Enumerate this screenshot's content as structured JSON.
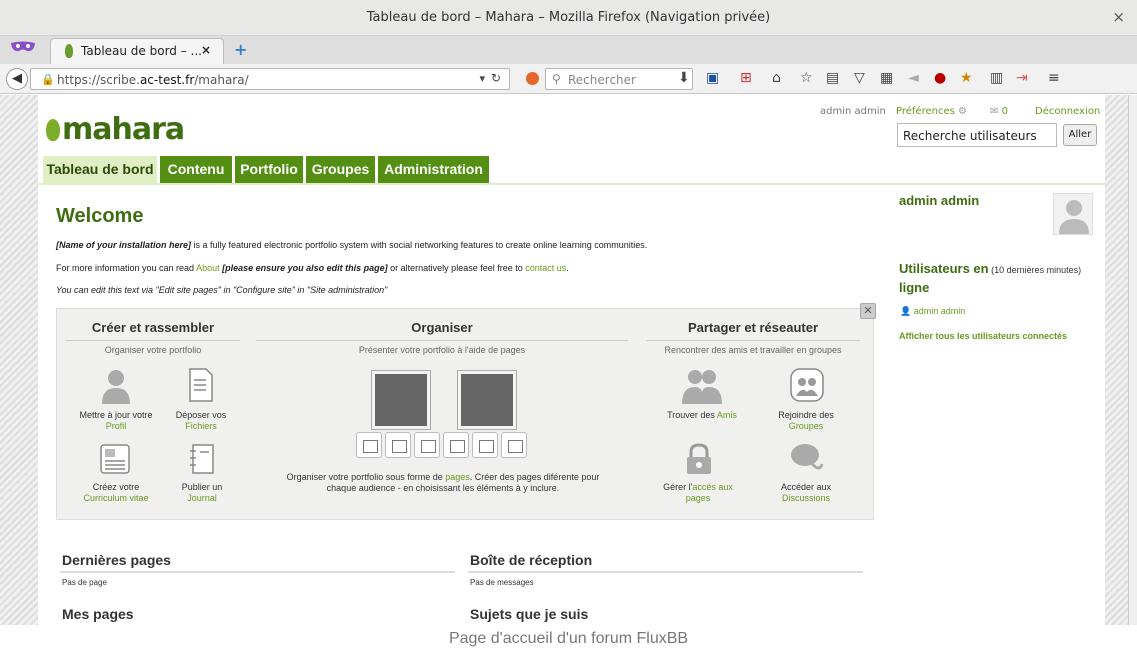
{
  "browser": {
    "window_title": "Tableau de bord – Mahara – Mozilla Firefox (Navigation privée)",
    "close_glyph": "×",
    "tab_title": "Tableau de bord – ...",
    "tab_close": "×",
    "new_tab": "+",
    "url_prefix": "https://scribe.",
    "url_domain": "ac-test.fr",
    "url_suffix": "/mahara/",
    "search_placeholder": "Rechercher"
  },
  "header": {
    "logo_text": "mahara",
    "user": "admin admin",
    "preferences": "Préférences",
    "inbox_count": "0",
    "logout": "Déconnexion",
    "user_search_value": "Recherche utilisateurs",
    "search_button": "Aller"
  },
  "nav": {
    "tabs": [
      "Tableau de bord",
      "Contenu",
      "Portfolio",
      "Groupes",
      "Administration"
    ],
    "selected": "Tableau de bord"
  },
  "main": {
    "welcome_title": "Welcome",
    "p1_bold": "[Name of your installation here]",
    "p1_rest": " is a fully featured electronic portfolio system with social networking features to create online learning communities.",
    "p2_a": "For more information you can read ",
    "p2_link1": "About",
    "p2_bold": " [please ensure you also edit this page]",
    "p2_b": " or alternatively please feel free to ",
    "p2_link2": "contact us",
    "p2_c": ".",
    "p3": "You can edit this text via \"Edit site pages\" in \"Configure site\" in \"Site administration\""
  },
  "quicklinks": {
    "close_glyph": "✕",
    "col1_title": "Créer et rassembler",
    "col1_sub": "Organiser votre portfolio",
    "col2_title": "Organiser",
    "col2_sub": "Présenter votre portfolio à l'aide de pages",
    "col3_title": "Partager et réseauter",
    "col3_sub": "Rencontrer des amis et travailler en groupes",
    "profile_a": "Mettre à jour votre",
    "profile_b": "Profil",
    "files_a": "Déposer vos",
    "files_b": "Fichiers",
    "cv_a": "Créez votre",
    "cv_b": "Curriculum vitae",
    "journal_a": "Publier un",
    "journal_b": "Journal",
    "organise_a": "Organiser votre portfolio sous forme de ",
    "organise_link": "pages",
    "organise_b": ". Créer des pages diférente pour",
    "organise_c": "chaque audience - en choisissant les éléments à y inclure.",
    "friends_a": "Trouver des ",
    "friends_b": "Amis",
    "groups_a": "Rejoindre des",
    "groups_b": "Groupes",
    "access_a": "Gérer l'",
    "access_b": "accès aux",
    "access_c": "pages",
    "disc_a": "Accéder aux",
    "disc_b": "Discussions"
  },
  "sidebar": {
    "profile_name": "admin admin",
    "online_title_a": "Utilisateurs en",
    "online_title_note": " (10 dernières minutes)",
    "online_title_b": "ligne",
    "online_user": "admin admin",
    "show_all": "Afficher tous les utilisateurs connectés"
  },
  "bottom": {
    "latest_pages": "Dernières pages",
    "no_pages": "Pas de page",
    "inbox": "Boîte de réception",
    "no_messages": "Pas de messages",
    "my_pages": "Mes pages",
    "topics": "Sujets que je suis"
  },
  "caption": "Page d'accueil d'un forum FluxBB",
  "colors": {
    "brand_green": "#548f14",
    "link_green": "#6a9a1f",
    "dark_green": "#3f6d12"
  }
}
